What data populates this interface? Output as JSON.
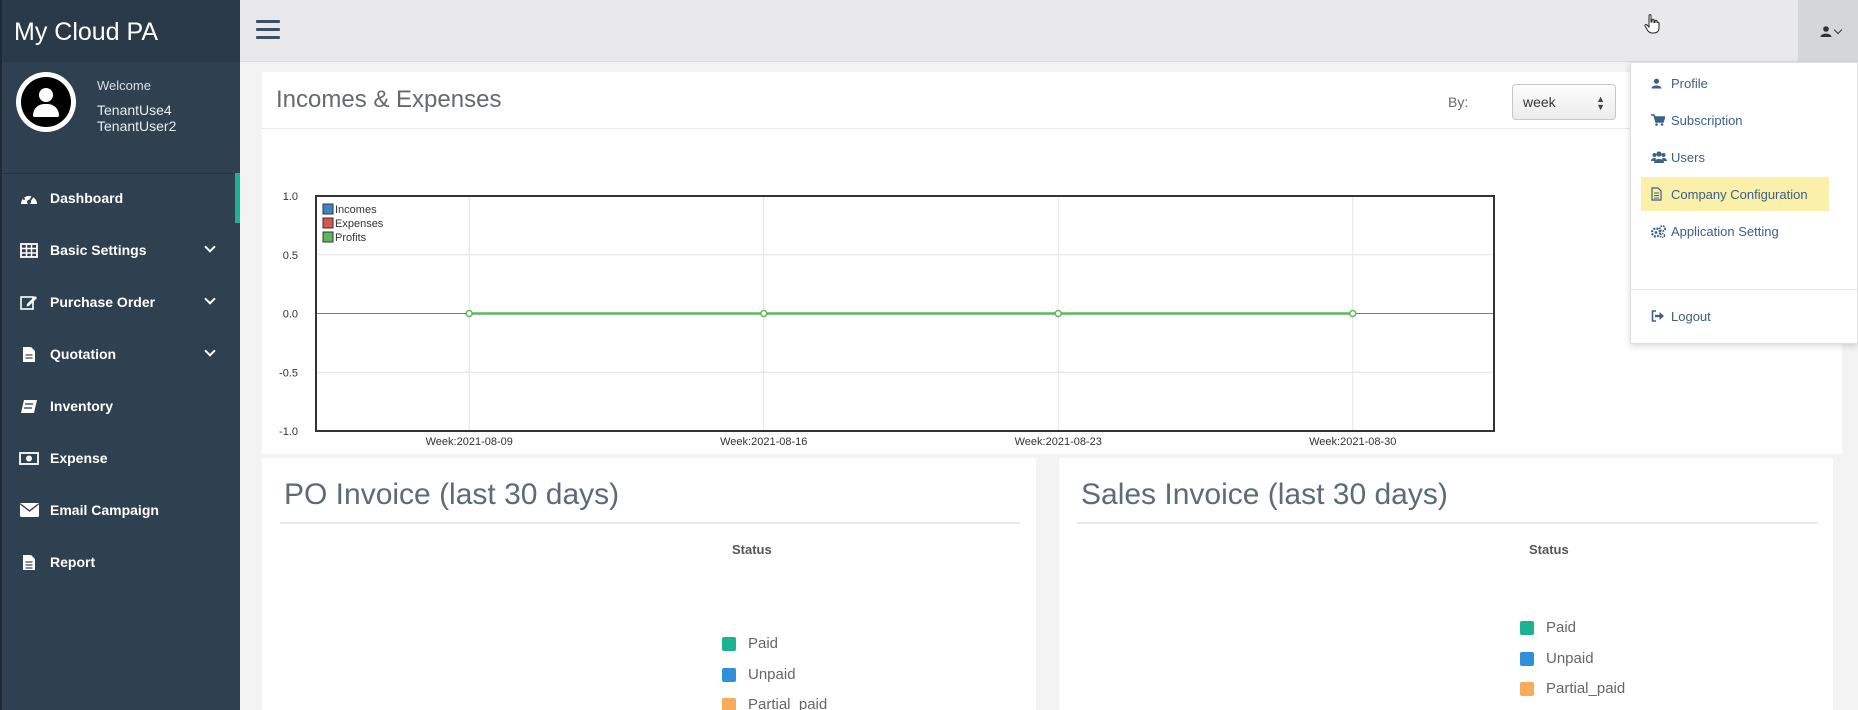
{
  "app": {
    "brand": "My Cloud PA"
  },
  "profile": {
    "welcome": "Welcome",
    "name_line1": "TenantUse4",
    "name_line2": "TenantUser2"
  },
  "sidebar": {
    "items": [
      {
        "label": "Dashboard",
        "icon": "dashboard-icon",
        "expandable": false,
        "active": true
      },
      {
        "label": "Basic Settings",
        "icon": "table-icon",
        "expandable": true
      },
      {
        "label": "Purchase Order",
        "icon": "edit-icon",
        "expandable": true
      },
      {
        "label": "Quotation",
        "icon": "file-icon",
        "expandable": true
      },
      {
        "label": "Inventory",
        "icon": "book-icon",
        "expandable": false
      },
      {
        "label": "Expense",
        "icon": "money-icon",
        "expandable": false
      },
      {
        "label": "Email Campaign",
        "icon": "envelope-icon",
        "expandable": false
      },
      {
        "label": "Report",
        "icon": "file-text-icon",
        "expandable": false
      }
    ]
  },
  "user_menu": {
    "items": [
      {
        "label": "Profile",
        "icon": "user-icon"
      },
      {
        "label": "Subscription",
        "icon": "cart-icon"
      },
      {
        "label": "Users",
        "icon": "users-icon"
      },
      {
        "label": "Company Configuration",
        "icon": "document-icon",
        "highlighted": true
      },
      {
        "label": "Application Setting",
        "icon": "cogs-icon"
      }
    ],
    "logout": {
      "label": "Logout",
      "icon": "sign-out-icon"
    }
  },
  "income_panel": {
    "title": "Incomes & Expenses",
    "by_label": "By:",
    "period_value": "week"
  },
  "chart_data": {
    "type": "line",
    "x": [
      "Week:2021-08-09",
      "Week:2021-08-16",
      "Week:2021-08-23",
      "Week:2021-08-30"
    ],
    "series": [
      {
        "name": "Incomes",
        "color": "#3a87c8",
        "values": [
          0,
          0,
          0,
          0
        ]
      },
      {
        "name": "Expenses",
        "color": "#d9534f",
        "values": [
          0,
          0,
          0,
          0
        ]
      },
      {
        "name": "Profits",
        "color": "#5cb85c",
        "values": [
          0,
          0,
          0,
          0
        ]
      }
    ],
    "yticks": [
      "1.0",
      "0.5",
      "0.0",
      "-0.5",
      "-1.0"
    ],
    "ylim": [
      -1,
      1
    ],
    "grid": true,
    "legend": "top-left"
  },
  "po_panel": {
    "title": "PO Invoice (last 30 days)",
    "status_label": "Status",
    "legend": [
      {
        "label": "Paid",
        "color": "#1ab394"
      },
      {
        "label": "Unpaid",
        "color": "#2f8fd8"
      },
      {
        "label": "Partial_paid",
        "color": "#f8ac59"
      }
    ]
  },
  "sales_panel": {
    "title": "Sales Invoice (last 30 days)",
    "status_label": "Status",
    "legend": [
      {
        "label": "Paid",
        "color": "#1ab394"
      },
      {
        "label": "Unpaid",
        "color": "#2f8fd8"
      },
      {
        "label": "Partial_paid",
        "color": "#f8ac59"
      }
    ]
  }
}
